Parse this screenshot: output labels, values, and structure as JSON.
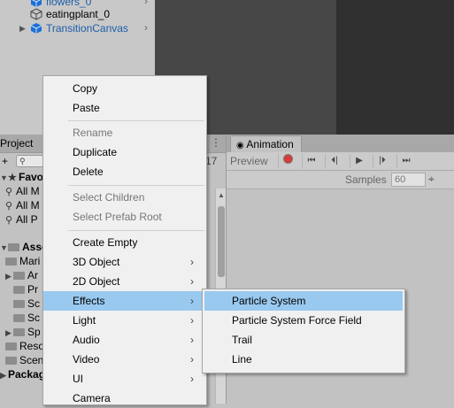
{
  "hierarchy": {
    "items": [
      {
        "label": "flowers_0",
        "expanded": false,
        "prefab": true
      },
      {
        "label": "eatingplant_0",
        "expanded": false,
        "prefab": false
      },
      {
        "label": "TransitionCanvas",
        "expanded": false,
        "prefab": true
      }
    ]
  },
  "project": {
    "tab_label": "Project",
    "favorites_label": "Favorit",
    "favorites": [
      "All M",
      "All M",
      "All P"
    ],
    "assets_label": "Assets",
    "asset_items": [
      "Mari",
      "Ar",
      "Pr",
      "Sc",
      "Sc",
      "Sp",
      "Reso",
      "Scen"
    ],
    "packages_label": "Packag",
    "search_icon_char": "🔍"
  },
  "animation": {
    "tab_label": "Animation",
    "preview_label": "Preview",
    "frame_partial": "17",
    "samples_label": "Samples",
    "samples_value": "60"
  },
  "context_menu": {
    "items": [
      {
        "label": "Copy",
        "disabled": false,
        "submenu": false
      },
      {
        "label": "Paste",
        "disabled": false,
        "submenu": false
      },
      {
        "label": "Rename",
        "disabled": true,
        "submenu": false
      },
      {
        "label": "Duplicate",
        "disabled": false,
        "submenu": false
      },
      {
        "label": "Delete",
        "disabled": false,
        "submenu": false
      },
      {
        "label": "Select Children",
        "disabled": true,
        "submenu": false
      },
      {
        "label": "Select Prefab Root",
        "disabled": true,
        "submenu": false
      },
      {
        "label": "Create Empty",
        "disabled": false,
        "submenu": false
      },
      {
        "label": "3D Object",
        "disabled": false,
        "submenu": true
      },
      {
        "label": "2D Object",
        "disabled": false,
        "submenu": true
      },
      {
        "label": "Effects",
        "disabled": false,
        "submenu": true,
        "highlighted": true
      },
      {
        "label": "Light",
        "disabled": false,
        "submenu": true
      },
      {
        "label": "Audio",
        "disabled": false,
        "submenu": true
      },
      {
        "label": "Video",
        "disabled": false,
        "submenu": true
      },
      {
        "label": "UI",
        "disabled": false,
        "submenu": true
      },
      {
        "label": "Camera",
        "disabled": false,
        "submenu": false
      }
    ]
  },
  "effects_submenu": {
    "items": [
      {
        "label": "Particle System",
        "highlighted": true
      },
      {
        "label": "Particle System Force Field",
        "highlighted": false
      },
      {
        "label": "Trail",
        "highlighted": false
      },
      {
        "label": "Line",
        "highlighted": false
      }
    ]
  },
  "colors": {
    "highlight": "#99c9ef",
    "prefab_blue": "#1d5ea8",
    "record_red": "#d83a3a"
  }
}
